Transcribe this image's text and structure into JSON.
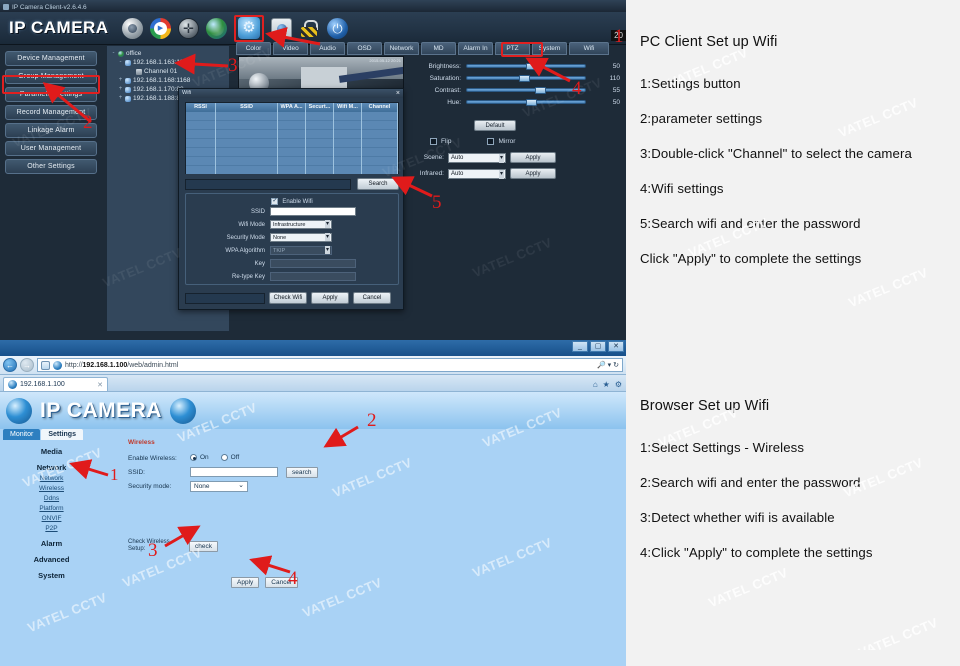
{
  "pc_client": {
    "window_title": "IP Camera Client-v2.6.4.6",
    "brand": "IP CAMERA",
    "toolbar_icons": [
      "camera-icon",
      "media-play-icon",
      "ptz-wheel-icon",
      "globe-icon",
      "settings-gear-icon",
      "snapshot-icon",
      "lock-icon",
      "power-icon"
    ],
    "clock_chip": "20",
    "nav_buttons": [
      "Device Management",
      "Group Management",
      "Parameter settings",
      "Record Management",
      "Linkage Alarm",
      "User Management",
      "Other Settings"
    ],
    "device_tree": [
      {
        "label": "office",
        "depth": 0,
        "icon": "globe-icon",
        "expander": "-"
      },
      {
        "label": "192.168.1.163:1163",
        "depth": 1,
        "icon": "device-icon",
        "expander": "-"
      },
      {
        "label": "Channel 01",
        "depth": 2,
        "icon": "channel-icon",
        "expander": ""
      },
      {
        "label": "192.168.1.168:1168",
        "depth": 1,
        "icon": "device-icon",
        "expander": "+"
      },
      {
        "label": "192.168.1.170:80",
        "depth": 1,
        "icon": "device-icon",
        "expander": "+"
      },
      {
        "label": "192.168.1.188:80",
        "depth": 1,
        "icon": "device-icon",
        "expander": "+"
      }
    ],
    "tabs": [
      "Color",
      "Video",
      "Audio",
      "OSD",
      "Network",
      "MD",
      "Alarm In",
      "PTZ",
      "System",
      "Wifi"
    ],
    "active_tab": "Wifi",
    "image_sliders": [
      {
        "label": "Brightness:",
        "value": "50",
        "pos": 50
      },
      {
        "label": "Saturation:",
        "value": "110",
        "pos": 44
      },
      {
        "label": "Contrast:",
        "value": "55",
        "pos": 58
      },
      {
        "label": "Hue:",
        "value": "50",
        "pos": 50
      }
    ],
    "default_button": "Default",
    "flip_label": "Flip",
    "mirror_label": "Mirror",
    "scene_label": "Scene:",
    "scene_value": "Auto",
    "infrared_label": "Infrared:",
    "infrared_value": "Auto",
    "apply_button": "Apply",
    "preview_stamp": "2015-05-12 20:21"
  },
  "wifi_dialog": {
    "title": "Wifi",
    "close_icon": "close-icon",
    "columns": [
      "RSSI",
      "SSID",
      "WPA A...",
      "Securt...",
      "Wifi M...",
      "Channel"
    ],
    "search_button": "Search",
    "search_field_value": "",
    "enable_wifi_label": "Enable Wifi",
    "enable_wifi_checked": true,
    "fields": [
      {
        "label": "SSID",
        "type": "text",
        "value": "",
        "enabled": true
      },
      {
        "label": "Wifi Mode",
        "type": "select",
        "value": "Infrastructure",
        "enabled": true
      },
      {
        "label": "Security Mode",
        "type": "select",
        "value": "None",
        "enabled": true
      },
      {
        "label": "WPA Algorithm",
        "type": "select",
        "value": "TKIP",
        "enabled": false
      },
      {
        "label": "Key",
        "type": "text",
        "value": "",
        "enabled": false
      },
      {
        "label": "Re-type Key",
        "type": "text",
        "value": "",
        "enabled": false
      }
    ],
    "buttons": [
      "Check Wifi",
      "Apply",
      "Cancel"
    ]
  },
  "browser": {
    "url": "http://192.168.1.100/web/admin.html",
    "url_host": "192.168.1.100",
    "url_path": "/web/admin.html",
    "url_scheme": "http://",
    "tab_title": "192.168.1.100",
    "window_controls": [
      "minimize",
      "maximize",
      "close"
    ],
    "nav_icons": [
      "back-icon",
      "forward-icon",
      "compatibility-icon",
      "refresh-icon",
      "search-icon"
    ],
    "toolbar_icons": [
      "home-icon",
      "favorites-star-icon",
      "tools-gear-icon"
    ],
    "brand": "IP CAMERA",
    "page_tabs": [
      "Monitor",
      "Settings"
    ],
    "active_page_tab": "Settings",
    "sidebar": [
      {
        "label": "Media",
        "type": "group"
      },
      {
        "label": "Network",
        "type": "group"
      },
      {
        "label": "Network",
        "type": "link"
      },
      {
        "label": "Wireless",
        "type": "link"
      },
      {
        "label": "Ddns",
        "type": "link"
      },
      {
        "label": "Platform",
        "type": "link"
      },
      {
        "label": "ONVIF",
        "type": "link"
      },
      {
        "label": "P2P",
        "type": "link"
      },
      {
        "label": "Alarm",
        "type": "group"
      },
      {
        "label": "Advanced",
        "type": "group"
      },
      {
        "label": "System",
        "type": "group"
      }
    ],
    "form": {
      "title": "Wireless",
      "enable_label": "Enable Wireless:",
      "radio_on": "On",
      "radio_off": "Off",
      "radio_selected": "On",
      "ssid_label": "SSID:",
      "ssid_value": "",
      "search_button": "search",
      "security_label": "Security mode:",
      "security_value": "None",
      "check_label": "Check Wireless Setup:",
      "check_button": "check",
      "apply_button": "Apply",
      "cancel_button": "Cancel"
    }
  },
  "annotations": {
    "pc": [
      "1",
      "2",
      "3",
      "4",
      "5"
    ],
    "browser": [
      "1",
      "2",
      "3",
      "4"
    ]
  },
  "instructions": {
    "pc_title": "PC Client Set up Wifi",
    "pc_steps": [
      "1:Settings button",
      "2:parameter settings",
      "3:Double-click \"Channel\" to select the camera",
      "4:Wifi settings",
      "5:Search wifi and enter the password",
      "Click \"Apply\" to complete the settings"
    ],
    "browser_title": "Browser Set up  Wifi",
    "browser_steps": [
      "1:Select Settings - Wireless",
      "2:Search wifi and enter the password",
      "3:Detect whether wifi is available",
      "4:Click \"Apply\" to complete the settings"
    ]
  },
  "watermark": {
    "text": "VATEL CCTV"
  },
  "colors": {
    "accent_red": "#e01b1b",
    "pc_bg": "#1e2b38",
    "web_bg": "#a9d2f5"
  }
}
